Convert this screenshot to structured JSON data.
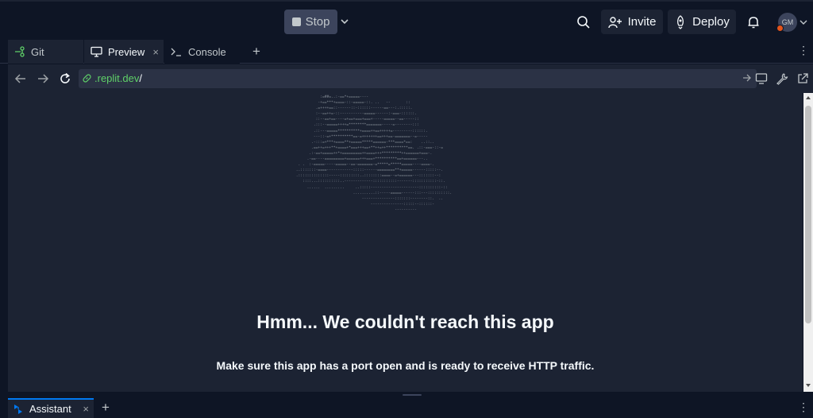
{
  "topbar": {
    "stop_label": "Stop",
    "invite_label": "Invite",
    "deploy_label": "Deploy",
    "avatar_initials": "GM"
  },
  "tabs": [
    {
      "label": "Git",
      "icon": "git-icon"
    },
    {
      "label": "Preview",
      "icon": "monitor-icon",
      "active": true
    },
    {
      "label": "Console",
      "icon": "terminal-icon"
    }
  ],
  "tab_close_glyph": "×",
  "url": {
    "host": ".replit.dev",
    "path": "/"
  },
  "preview": {
    "ascii_art": "            :=##=..:-==*+=====----\n           -+==***+====-::-=====-::. ..   --       ::\n          .=++++==::------::-::::::------==---:.:::::.\n          :--==++=-::-----------=====------:-===-::::::.\n          ::--==+==----=+==+===+===+-----=====--==-----::\n         .:::--=====++++=********=======-----=--------:::\n         .::---=====**********+====++==+++++=---------::::::.\n         ---::-=+**********==-=+++++++==+++==-=======--=-----\n        .-:::=+***+====**+=====*****======-***====*==:    ..::..\n        .==++=+++**+====+*===+++==+**++=++**********==. .::-===-::-=\n       .:-==+=====++*+=========++====+++*********++======+===-.\n      .-==----=========+======+++===+**********==+======---..\n  . .  :-=====-----=====--==-=======-=*****=*****=====----====-.\n ..:::::::-====------------:::::------========**+=====------:::::--.\n .::::::::::::::-----:::::::::..::::::::====--=+======---:::::::--:\n    ::::...::::::::::..-------------:::::::::::-------:::::::::::-::.\n      ......  .........     ..:::::----------------------::::::::::-::\n                           ..........::-----=====------:::---::::::::::.\n                               ---------------:::::::--------::.  ..\n                                   ---------------:::::--::::::-\n                                              ----------",
    "error_title": "Hmm... We couldn't reach this app",
    "error_subtitle": "Make sure this app has a port open and is ready to receive HTTP traffic."
  },
  "bottom": {
    "assistant_label": "Assistant"
  },
  "colors": {
    "bg": "#0e1525",
    "surface": "#1c2333",
    "accent": "#0079f2",
    "url_host": "#5fd068"
  }
}
